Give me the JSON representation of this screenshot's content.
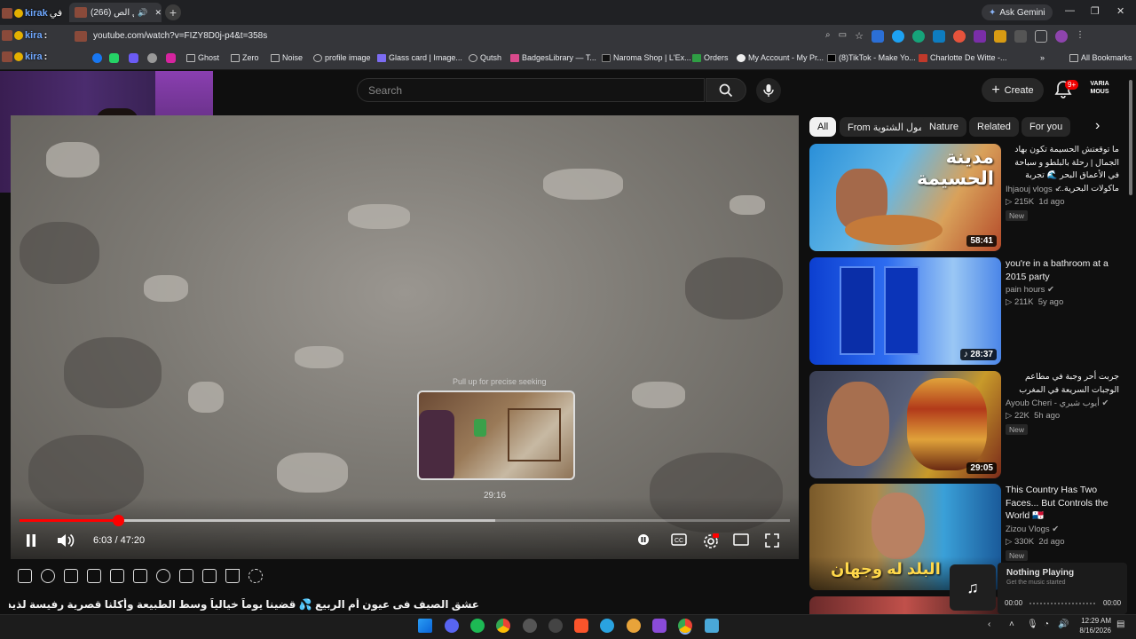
{
  "browser": {
    "tab_title": "(266) عشق الص...",
    "address": "youtube.com/watch?v=FIZY8D0j-p4&t=358s",
    "ask_gemini": "Ask Gemini",
    "bookmarks": [
      "Ghost",
      "Zero",
      "Noise",
      "profile image",
      "Glass card | Image...",
      "Qutsh",
      "BadgesLibrary — T...",
      "Naroma Shop | L'Ex...",
      "Orders",
      "My Account - My Pr...",
      "(8)TikTok - Make Yo...",
      "Charlotte De Witte -..."
    ],
    "all_bookmarks": "All Bookmarks",
    "window_controls": [
      "—",
      "❐",
      "✕"
    ]
  },
  "stream_overlay": {
    "chat": [
      {
        "name": "kirak",
        "text": "في"
      },
      {
        "name": "kira",
        "text": ":"
      },
      {
        "name": "kira",
        "text": ":"
      }
    ]
  },
  "youtube": {
    "search_placeholder": "Search",
    "create_label": "Create",
    "notification_count": "9+",
    "avatar_text": "VARIA MOUS",
    "chips": [
      "All",
      "From مول الشتوية",
      "Nature",
      "Related",
      "For you"
    ],
    "player": {
      "time_current": "6:03",
      "time_total": "47:20",
      "time_display": "6:03 / 47:20",
      "progress_fraction": 0.128,
      "preview_time": "29:16",
      "preview_hint": "Pull up for precise seeking",
      "preview_position_fraction": 0.618
    },
    "video_title": "عشق الصيف فى عيون أم الربيع 💦 قضينا يوماً خيالياً وسط الطبيعة وأكلنا قصرية رفيسة لذيذة 😍🔥",
    "recommendations": [
      {
        "title": "ما توقعتش الحسيمة تكون بهاد الجمال | رحلة بالبلطو و سباحة في الأعماق البحر 🌊 تجربة ماكولات البحرية...",
        "rtl": true,
        "channel": "Ihjaouj vlogs",
        "verified": true,
        "views": "215K",
        "age": "1d ago",
        "badge": "New",
        "duration": "58:41",
        "thumb_text": "مدينة الحسيمة"
      },
      {
        "title": "you're in a bathroom at a 2015 party",
        "rtl": false,
        "channel": "pain hours",
        "verified": true,
        "views": "211K",
        "age": "5y ago",
        "badge": "",
        "duration": "28:37",
        "thumb_text": ""
      },
      {
        "title": "جربت أحر وجبة في مطاعم الوجبات السريعة في المغرب",
        "rtl": true,
        "channel": "Ayoub Cheri - أيوب شيري",
        "verified": true,
        "views": "22K",
        "age": "5h ago",
        "badge": "New",
        "duration": "29:05",
        "thumb_text": ""
      },
      {
        "title": "This Country Has Two Faces... But Controls the World 🇵🇦",
        "rtl": false,
        "channel": "Zizou Vlogs",
        "verified": true,
        "views": "330K",
        "age": "2d ago",
        "badge": "New",
        "duration": "",
        "thumb_text": "البلد له وجهان"
      }
    ]
  },
  "now_playing": {
    "title": "Nothing Playing",
    "subtitle": "Get the music started",
    "time_left": "00:00",
    "time_right": "00:00"
  },
  "taskbar": {
    "time": "12:29 AM",
    "date": "8/16/2026"
  },
  "colors": {
    "youtube_red": "#ff0000",
    "background": "#0f0f0f",
    "chip_bg": "#272727"
  }
}
